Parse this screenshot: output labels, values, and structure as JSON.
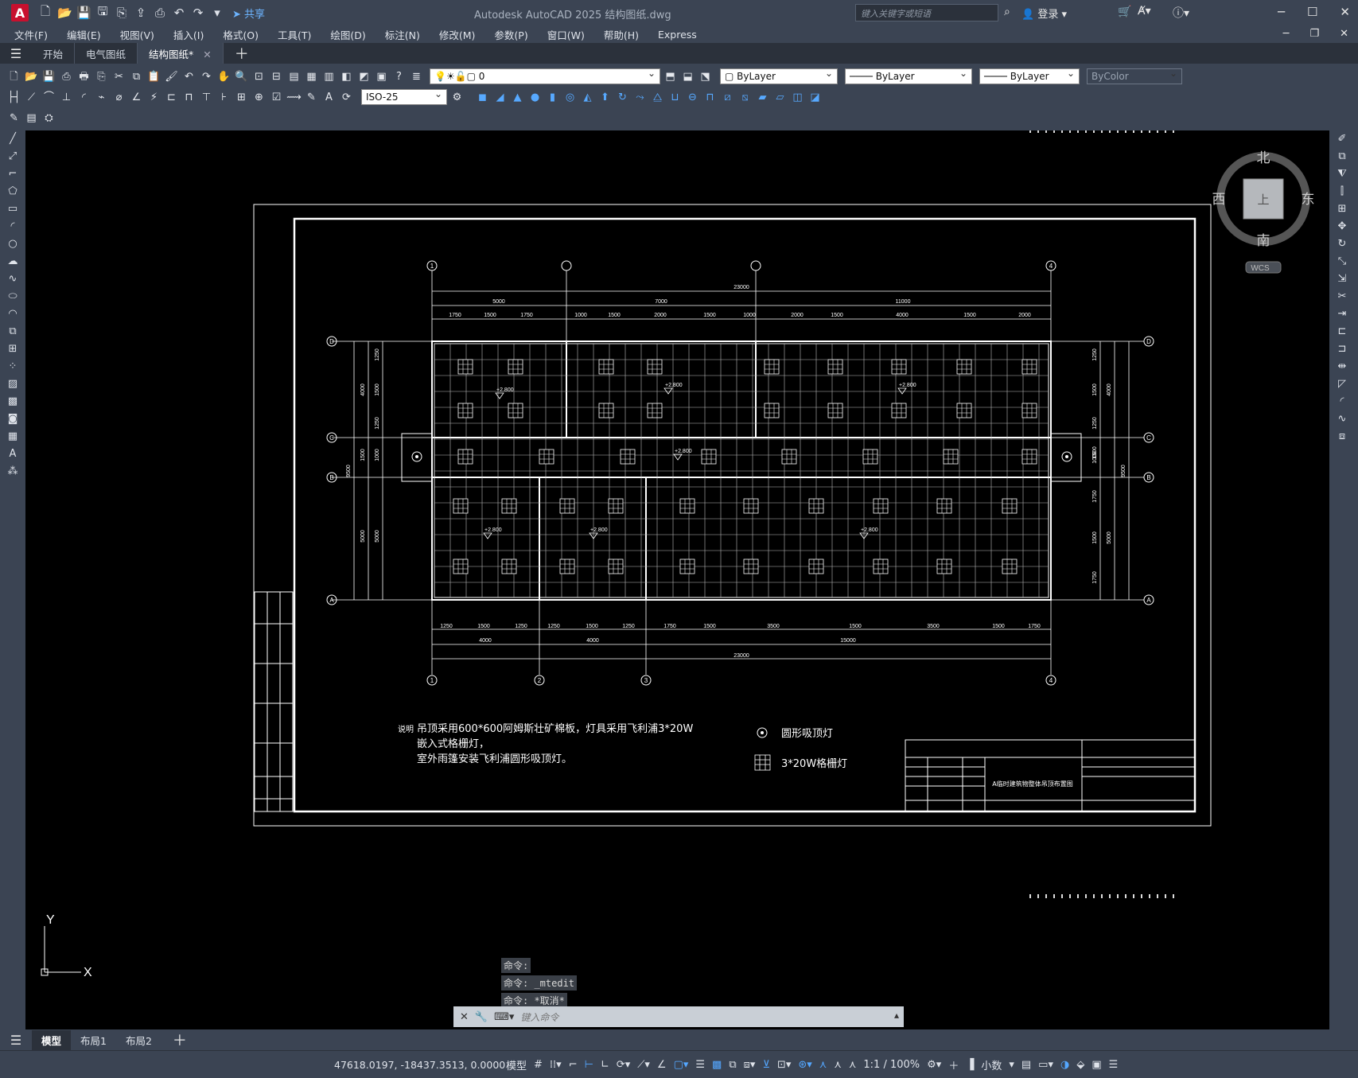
{
  "titlebar": {
    "app_logo": "A",
    "share_label": "共享",
    "title": "Autodesk AutoCAD 2025    结构图纸.dwg",
    "search_placeholder": "键入关键字或短语",
    "login_label": "登录"
  },
  "menu": {
    "items": [
      "文件(F)",
      "编辑(E)",
      "视图(V)",
      "插入(I)",
      "格式(O)",
      "工具(T)",
      "绘图(D)",
      "标注(N)",
      "修改(M)",
      "参数(P)",
      "窗口(W)",
      "帮助(H)",
      "Express"
    ]
  },
  "doc_tabs": {
    "items": [
      "开始",
      "电气图纸",
      "结构图纸*"
    ]
  },
  "toolbar": {
    "layer_value": "0",
    "color_value": "ByLayer",
    "linetype_value": "ByLayer",
    "lineweight_value": "ByLayer",
    "plotstyle_value": "ByColor",
    "dimstyle_value": "ISO-25"
  },
  "viewcube": {
    "north": "北",
    "south": "南",
    "east": "东",
    "west": "西",
    "top_face": "上",
    "wcs_label": "WCS"
  },
  "drawing": {
    "grid_top": [
      "1",
      "",
      "",
      "4"
    ],
    "grid_bottom": [
      "1",
      "2",
      "3",
      "4"
    ],
    "grid_sides": [
      "D",
      "C",
      "B",
      "A"
    ],
    "dim_total": "23000",
    "dim_top_row1": [
      "5000",
      "7000",
      "11000"
    ],
    "dim_top_row2": [
      "1750",
      "1500",
      "1750",
      "1000",
      "1500",
      "2000",
      "1500",
      "1000",
      "2000",
      "1500",
      "4000",
      "1500",
      "2000"
    ],
    "dim_bottom_row1": [
      "1250",
      "1500",
      "1250",
      "1250",
      "1500",
      "1250",
      "1750",
      "1500",
      "3500",
      "1500",
      "3500",
      "1500",
      "1750"
    ],
    "dim_bottom_row2": [
      "4000",
      "4000",
      "15000"
    ],
    "dim_left": [
      "1250",
      "1500",
      "1250",
      "4000",
      "1500",
      "1000",
      "9500",
      "5000",
      "5000"
    ],
    "dim_right": [
      "1250",
      "1500",
      "1250",
      "4000",
      "1000",
      "1500",
      "9500",
      "1750",
      "1500",
      "1750",
      "5000"
    ],
    "elevation": "+2.800",
    "note_label": "说明",
    "note_lines": [
      "吊顶采用600*600阿姆斯壮矿棉板，灯具采用飞利浦3*20W",
      "嵌入式格栅灯，",
      "室外雨篷安装飞利浦圆形吸顶灯。"
    ],
    "legend": [
      "圆形吸顶灯",
      "3*20W格栅灯"
    ],
    "title_block_name": "A临时建筑物整体吊顶布置图"
  },
  "command": {
    "history": [
      "命令:",
      "命令: _mtedit",
      "命令: *取消*"
    ],
    "placeholder": "键入命令"
  },
  "layout_tabs": {
    "items": [
      "模型",
      "布局1",
      "布局2"
    ]
  },
  "status": {
    "coords": "47618.0197, -18437.3513, 0.0000",
    "model_label": "模型",
    "scale": "1:1 / 100%",
    "units": "小数"
  }
}
